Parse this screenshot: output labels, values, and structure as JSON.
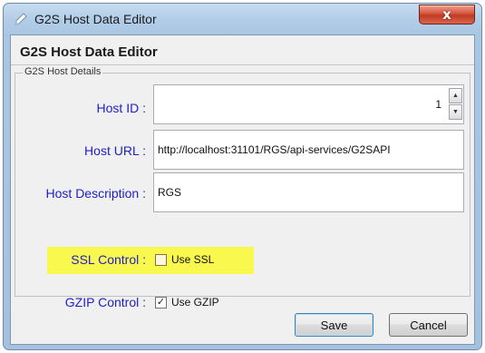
{
  "window": {
    "title": "G2S Host Data Editor",
    "close_glyph": "x",
    "icon": "pencil-icon"
  },
  "dialog": {
    "heading": "G2S Host Data Editor",
    "group_title": "G2S Host Details"
  },
  "fields": {
    "host_id": {
      "label": "Host ID :",
      "value": "1"
    },
    "host_url": {
      "label": "Host URL :",
      "value": "http://localhost:31101/RGS/api-services/G2SAPI"
    },
    "host_description": {
      "label": "Host Description :",
      "value": "RGS"
    },
    "ssl_control": {
      "label": "SSL Control :",
      "checkbox_label": "Use SSL",
      "checked": false
    },
    "gzip_control": {
      "label": "GZIP Control :",
      "checkbox_label": "Use GZIP",
      "checked": true
    }
  },
  "buttons": {
    "save": "Save",
    "cancel": "Cancel"
  },
  "colors": {
    "label_blue": "#2020c8",
    "highlight_yellow": "#f8f84f",
    "close_red": "#c13a23"
  }
}
